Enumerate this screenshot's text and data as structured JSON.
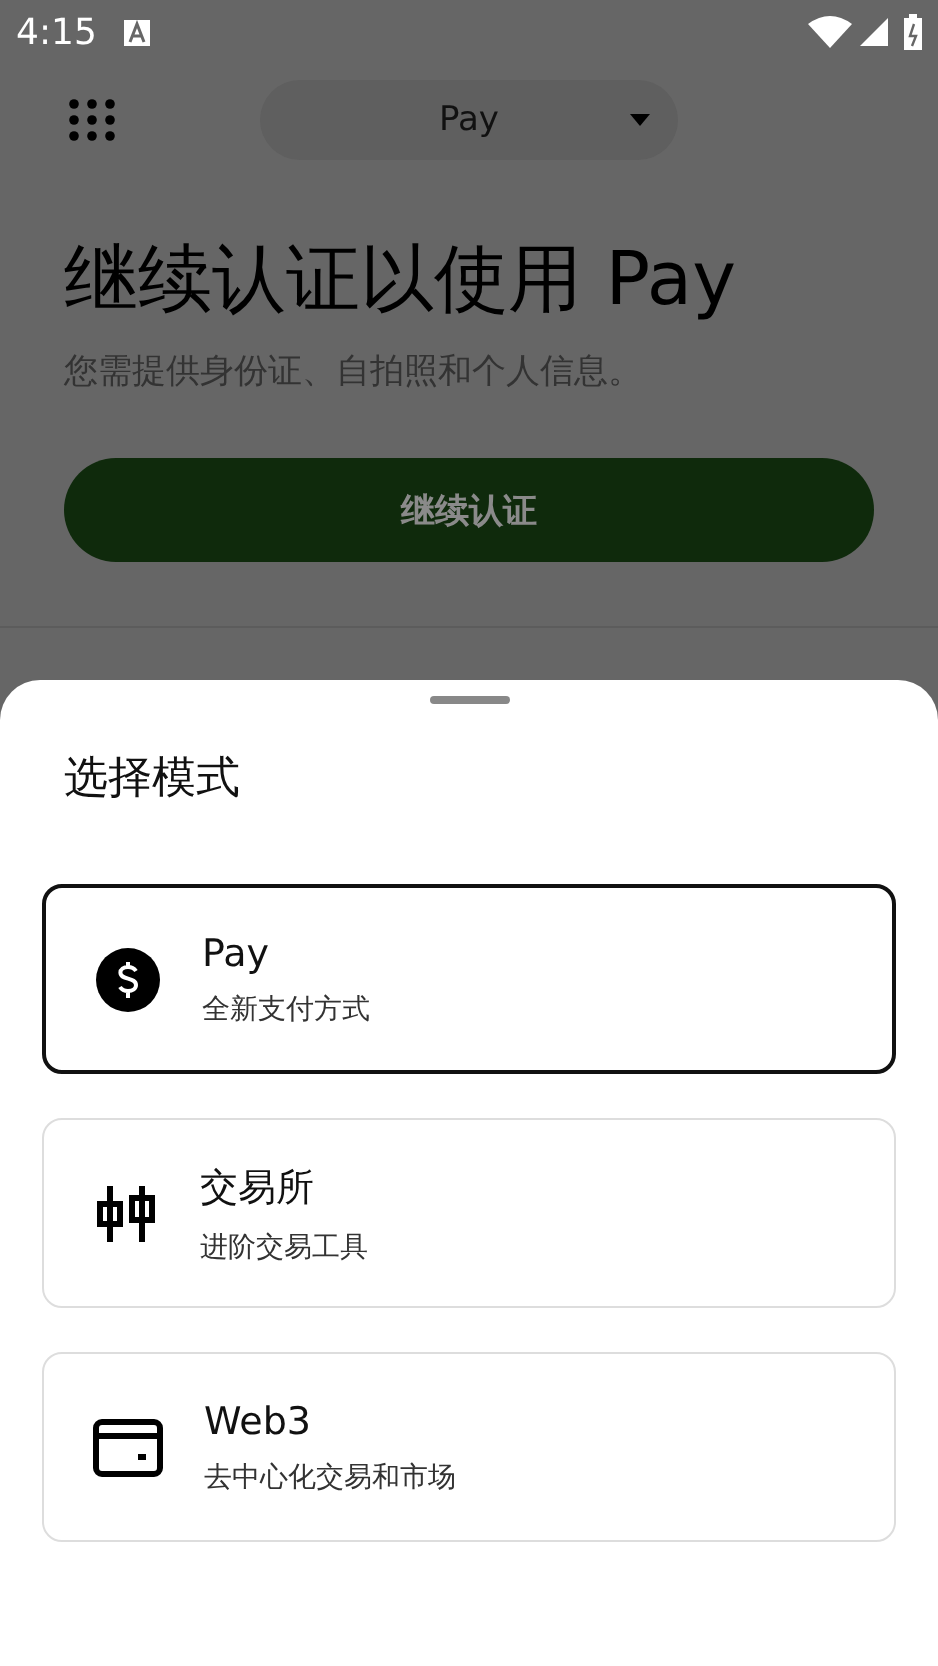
{
  "status_bar": {
    "time": "4:15"
  },
  "app_bar": {
    "selector": {
      "label": "Pay"
    }
  },
  "hero": {
    "title": "继续认证以使用 Pay",
    "subtitle": "您需提供身份证、自拍照和个人信息。",
    "button": "继续认证"
  },
  "sheet": {
    "title": "选择模式",
    "modes": [
      {
        "kind": "pay",
        "title": "Pay",
        "subtitle": "全新支付方式",
        "selected": true
      },
      {
        "kind": "exchange",
        "title": "交易所",
        "subtitle": "进阶交易工具",
        "selected": false
      },
      {
        "kind": "web3",
        "title": "Web3",
        "subtitle": "去中心化交易和市场",
        "selected": false
      }
    ]
  }
}
